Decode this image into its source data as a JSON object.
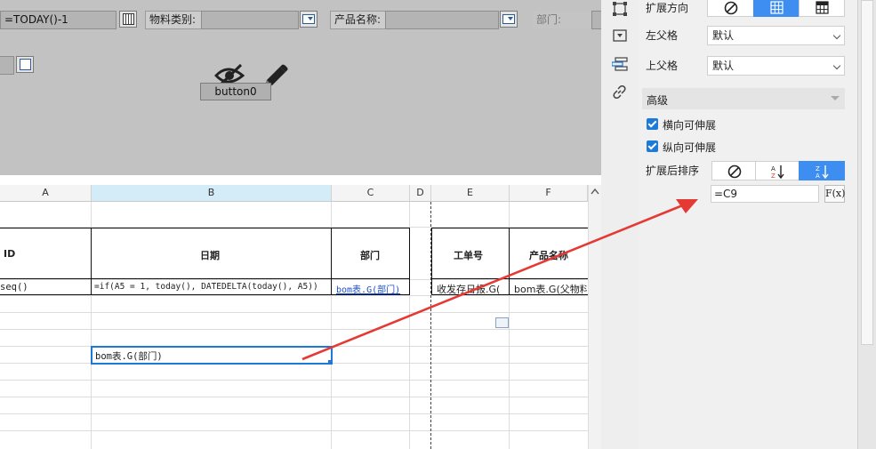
{
  "param_panel": {
    "date_formula": "=TODAY()-1",
    "material_type_label": "物料类别:",
    "product_name_label": "产品名称:",
    "department_label": "部门:",
    "button_label": "button0"
  },
  "sheet": {
    "columns": [
      "A",
      "B",
      "C",
      "D",
      "E",
      "F"
    ],
    "header_row": {
      "a": "ID",
      "b": "日期",
      "c": "部门",
      "e": "工单号",
      "f": "产品名称"
    },
    "formula_row": {
      "a": "seq()",
      "b": "=if(A5 = 1, today(), DATEDELTA(today(), A5))",
      "c": "bom表.G(部门)",
      "e": "收发存日报.G(",
      "f": "bom表.G(父物料"
    },
    "selected_cell": "bom表.G(部门)"
  },
  "properties": {
    "expand_direction_label": "扩展方向",
    "left_parent_label": "左父格",
    "left_parent_value": "默认",
    "top_parent_label": "上父格",
    "top_parent_value": "默认",
    "advanced_label": "高级",
    "horizontal_expand_label": "横向可伸展",
    "vertical_expand_label": "纵向可伸展",
    "sort_label": "扩展后排序",
    "sort_formula": "=C9",
    "formula_button": "F(x)"
  },
  "annotation": {
    "arrow_color": "#e53935"
  }
}
